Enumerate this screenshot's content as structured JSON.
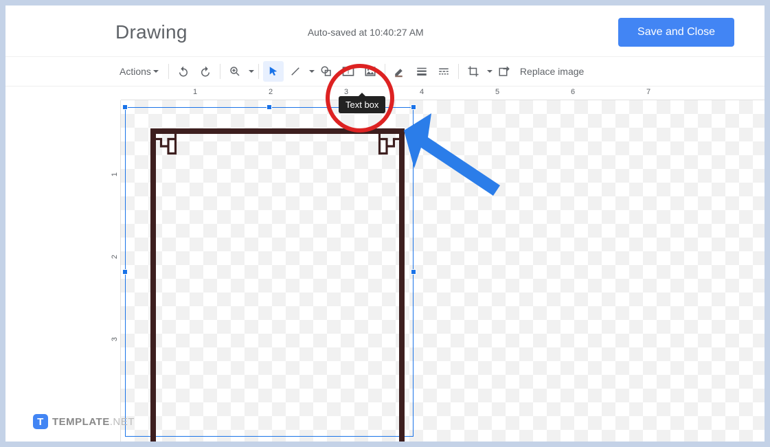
{
  "header": {
    "title": "Drawing",
    "autosave": "Auto-saved at 10:40:27 AM",
    "save_button": "Save and Close"
  },
  "toolbar": {
    "actions_label": "Actions",
    "replace_image": "Replace image",
    "tooltip_text": "Text box"
  },
  "ruler_h": [
    "1",
    "2",
    "3",
    "4",
    "5",
    "6",
    "7"
  ],
  "ruler_v": [
    "1",
    "2",
    "3"
  ],
  "watermark": {
    "brand": "TEMPLATE",
    "domain": ".NET",
    "badge": "T"
  },
  "icons": {
    "undo": "undo-icon",
    "redo": "redo-icon",
    "zoom": "zoom-icon",
    "select": "select-icon",
    "line": "line-icon",
    "shape": "shape-icon",
    "textbox": "textbox-icon",
    "image": "image-icon",
    "pen": "pen-icon",
    "weight": "line-weight-icon",
    "dash": "line-dash-icon",
    "crop": "crop-icon",
    "reset": "reset-image-icon"
  }
}
